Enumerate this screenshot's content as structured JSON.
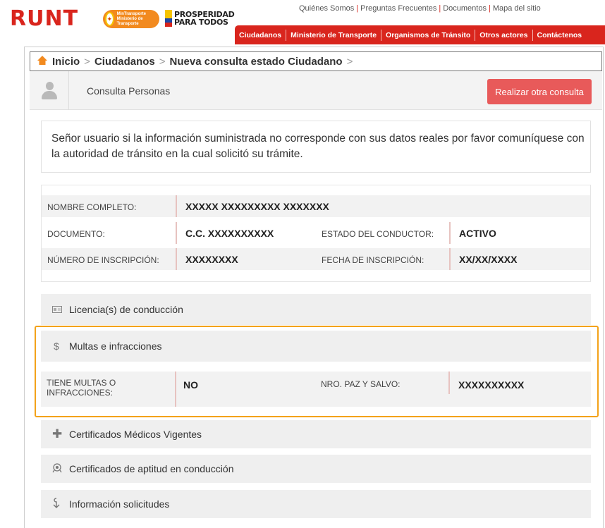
{
  "header": {
    "logo": "RUNT",
    "mintransporte_logo": "MinTransporte Ministerio de Transporte",
    "prosperidad_logo": [
      "PROSPERIDAD",
      "PARA TODOS"
    ],
    "top_links": [
      "Quiénes Somos",
      "Preguntas Frecuentes",
      "Documentos",
      "Mapa del sitio"
    ],
    "nav": [
      "Ciudadanos",
      "Ministerio de Transporte",
      "Organismos de Tránsito",
      "Otros actores",
      "Contáctenos"
    ],
    "brand_red": "#d9251d"
  },
  "breadcrumb": {
    "home_icon": "home-icon",
    "items": [
      "Inicio",
      "Ciudadanos",
      "Nueva consulta estado Ciudadano"
    ]
  },
  "consult": {
    "title": "Consulta Personas",
    "button": "Realizar otra consulta"
  },
  "notice": "Señor usuario si la información suministrada no corresponde con sus datos reales por favor comuníquese con la autoridad de tránsito en la cual solicitó su trámite.",
  "person": {
    "nombre_label": "NOMBRE COMPLETO:",
    "nombre_value": "XXXXX XXXXXXXXX XXXXXXX",
    "documento_label": "DOCUMENTO:",
    "documento_value": "C.C. XXXXXXXXXX",
    "estado_label": "ESTADO DEL CONDUCTOR:",
    "estado_value": "ACTIVO",
    "inscripcion_label": "NÚMERO DE INSCRIPCIÓN:",
    "inscripcion_value": "XXXXXXXX",
    "fecha_label": "FECHA DE INSCRIPCIÓN:",
    "fecha_value": "XX/XX/XXXX"
  },
  "panels": {
    "licencias": "Licencia(s) de conducción",
    "multas": "Multas e infracciones",
    "certificados_medicos": "Certificados Médicos Vigentes",
    "certificados_aptitud": "Certificados de aptitud en conducción",
    "informacion": "Información solicitudes"
  },
  "multas": {
    "tiene_label": "TIENE MULTAS O INFRACCIONES:",
    "tiene_value": "NO",
    "paz_label": "NRO. PAZ Y SALVO:",
    "paz_value": "XXXXXXXXXX",
    "highlight_color": "#f3a21a"
  }
}
